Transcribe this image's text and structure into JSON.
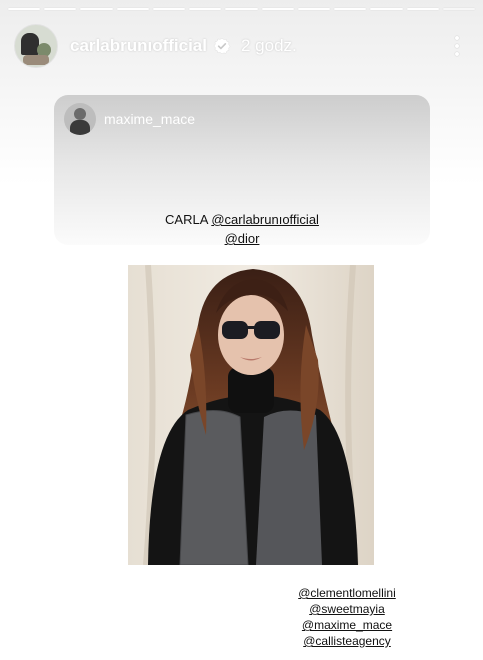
{
  "story": {
    "segments_total": 13,
    "active_segment_index": 12,
    "username": "carlabrunıofficial",
    "timestamp": "2 godz."
  },
  "shared_post": {
    "author": "maxime_mace",
    "caption_prefix": "CARLA",
    "caption_tag_1": "@carlabrunıofficial",
    "caption_tag_2": "@dior",
    "photo_alt": "Woman with long auburn hair, dark sunglasses, black turtleneck and grey tweed sleeveless vest"
  },
  "mentions": [
    "@clementlomellini",
    "@sweetmayia",
    "@maxime_mace",
    "@callisteagency"
  ],
  "icons": {
    "verified": "verified-badge-icon",
    "more": "more-options-icon"
  },
  "colors": {
    "verified_badge": "#ffffff",
    "text": "#111111"
  }
}
